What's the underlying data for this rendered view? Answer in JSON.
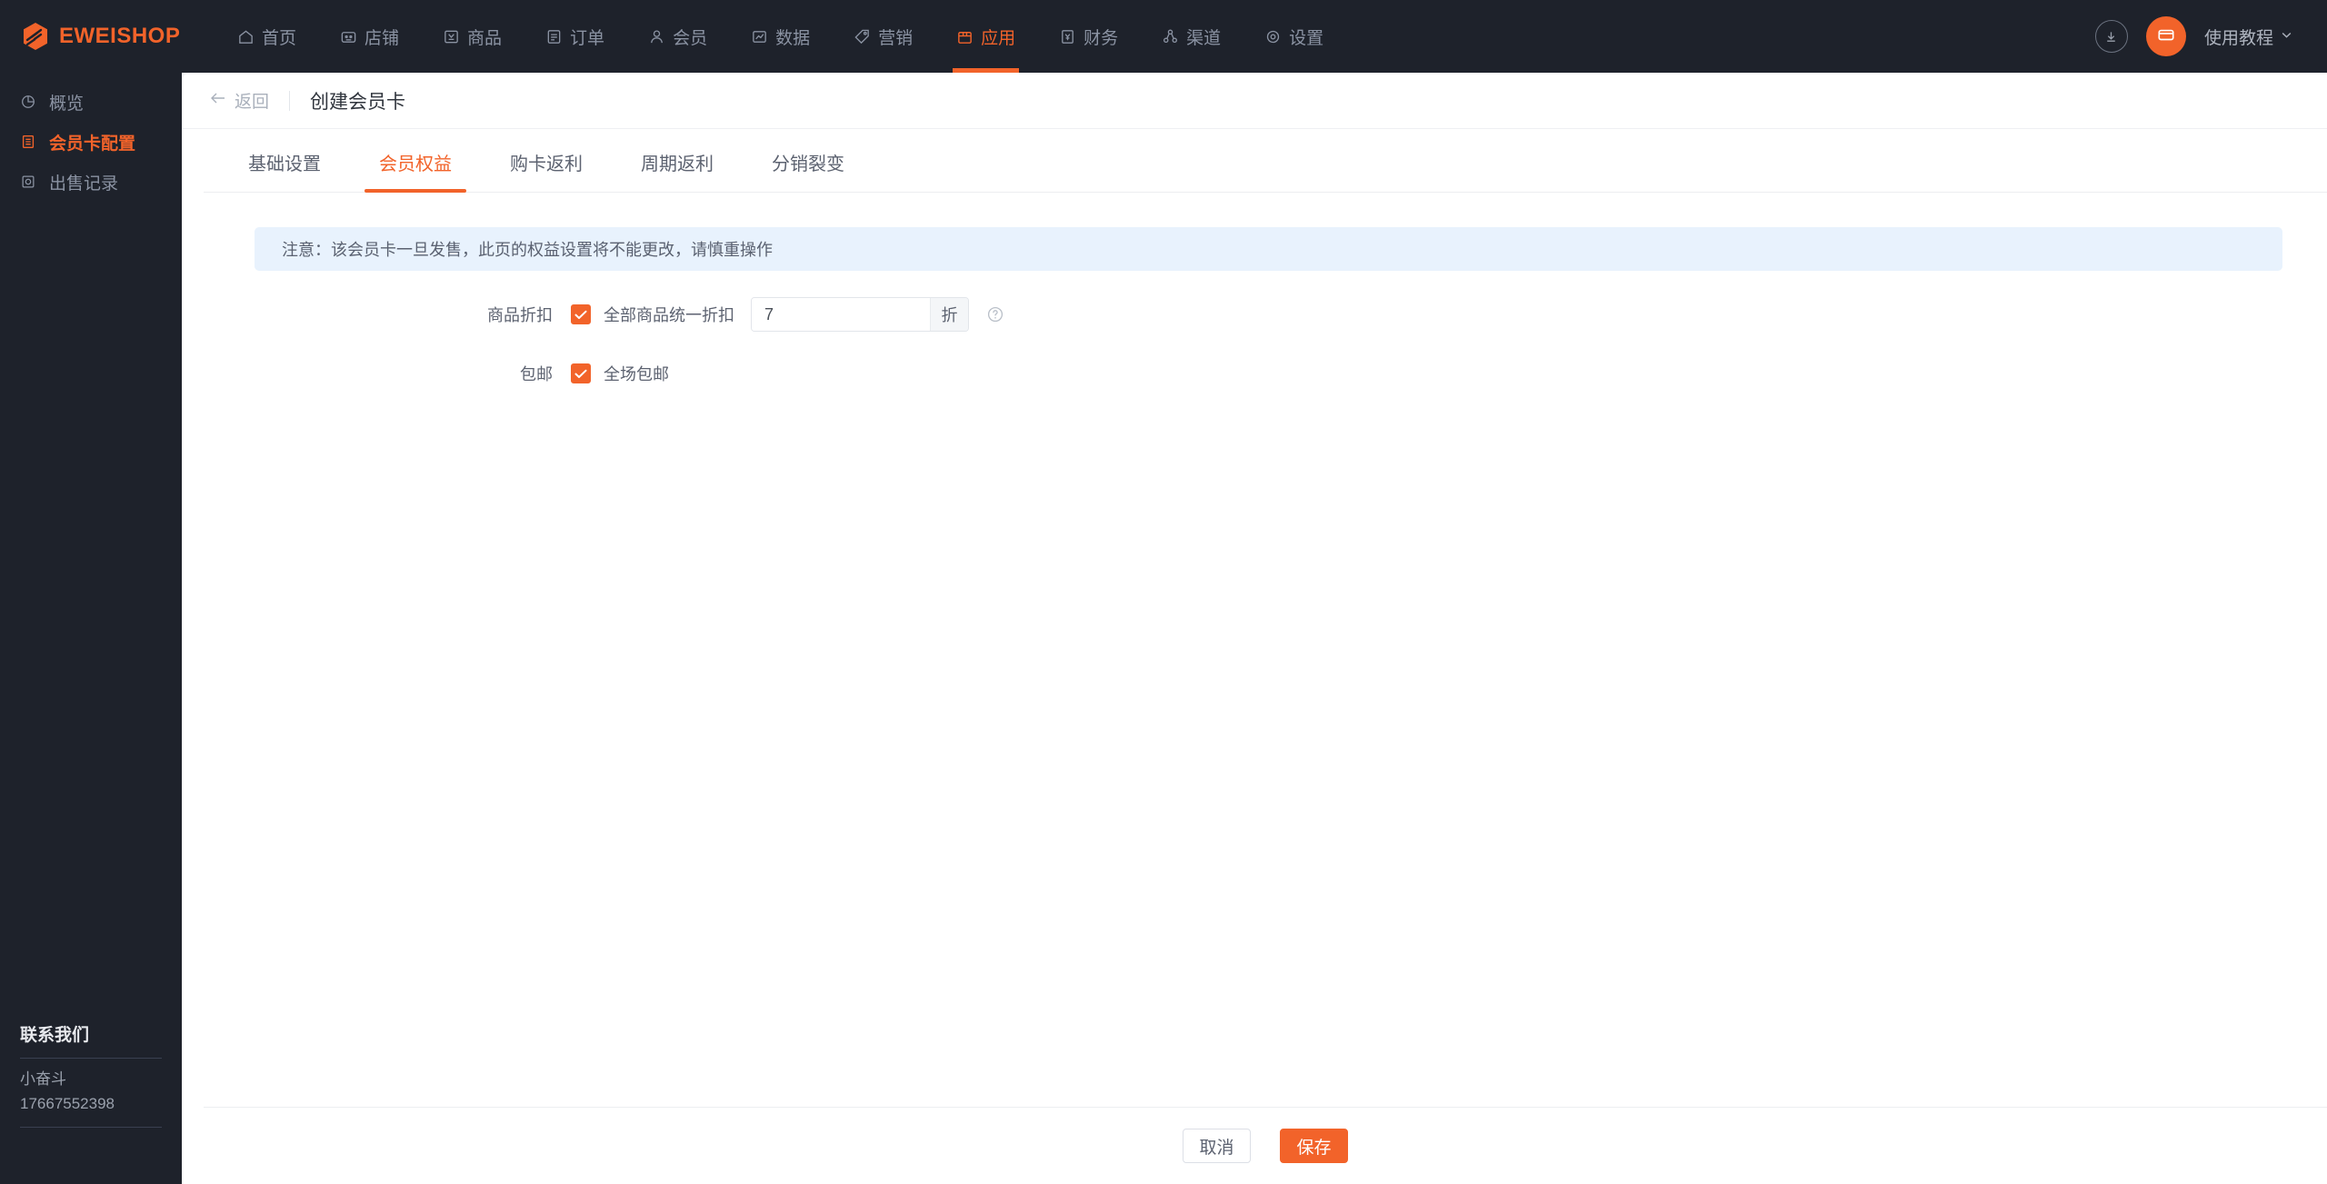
{
  "brand": {
    "name": "EWEISHOP",
    "accent": "#f2632a",
    "header_bg": "#1e222b"
  },
  "topnav": {
    "items": [
      {
        "label": "首页",
        "icon": "home-icon",
        "active": false
      },
      {
        "label": "店铺",
        "icon": "shop-icon",
        "active": false
      },
      {
        "label": "商品",
        "icon": "goods-icon",
        "active": false
      },
      {
        "label": "订单",
        "icon": "order-icon",
        "active": false
      },
      {
        "label": "会员",
        "icon": "member-icon",
        "active": false
      },
      {
        "label": "数据",
        "icon": "chart-icon",
        "active": false
      },
      {
        "label": "营销",
        "icon": "tag-icon",
        "active": false
      },
      {
        "label": "应用",
        "icon": "app-icon",
        "active": true
      },
      {
        "label": "财务",
        "icon": "finance-icon",
        "active": false
      },
      {
        "label": "渠道",
        "icon": "channel-icon",
        "active": false
      },
      {
        "label": "设置",
        "icon": "gear-icon",
        "active": false
      }
    ],
    "download_icon": "download-icon",
    "avatar_icon": "shop-avatar-icon",
    "tutorial_label": "使用教程",
    "tutorial_caret": "chevron-down-icon"
  },
  "sidebar": {
    "items": [
      {
        "label": "概览",
        "icon": "pie-chart-icon",
        "active": false
      },
      {
        "label": "会员卡配置",
        "icon": "card-list-icon",
        "active": true
      },
      {
        "label": "出售记录",
        "icon": "record-icon",
        "active": false
      }
    ],
    "contact": {
      "title": "联系我们",
      "name": "小奋斗",
      "phone": "17667552398"
    }
  },
  "page": {
    "back_label": "返回",
    "back_icon": "arrow-left-icon",
    "title": "创建会员卡"
  },
  "tabs": [
    {
      "label": "基础设置",
      "active": false
    },
    {
      "label": "会员权益",
      "active": true
    },
    {
      "label": "购卡返利",
      "active": false
    },
    {
      "label": "周期返利",
      "active": false
    },
    {
      "label": "分销裂变",
      "active": false
    }
  ],
  "alert": {
    "text": "注意：该会员卡一旦发售，此页的权益设置将不能更改，请慎重操作",
    "bg": "#e8f2fd"
  },
  "form": {
    "discount": {
      "label": "商品折扣",
      "checkbox_label": "全部商品统一折扣",
      "checked": true,
      "value": "7",
      "placeholder": "",
      "unit": "折",
      "help_icon": "question-circle-icon"
    },
    "shipping": {
      "label": "包邮",
      "checkbox_label": "全场包邮",
      "checked": true
    }
  },
  "footer": {
    "cancel_label": "取消",
    "save_label": "保存"
  }
}
